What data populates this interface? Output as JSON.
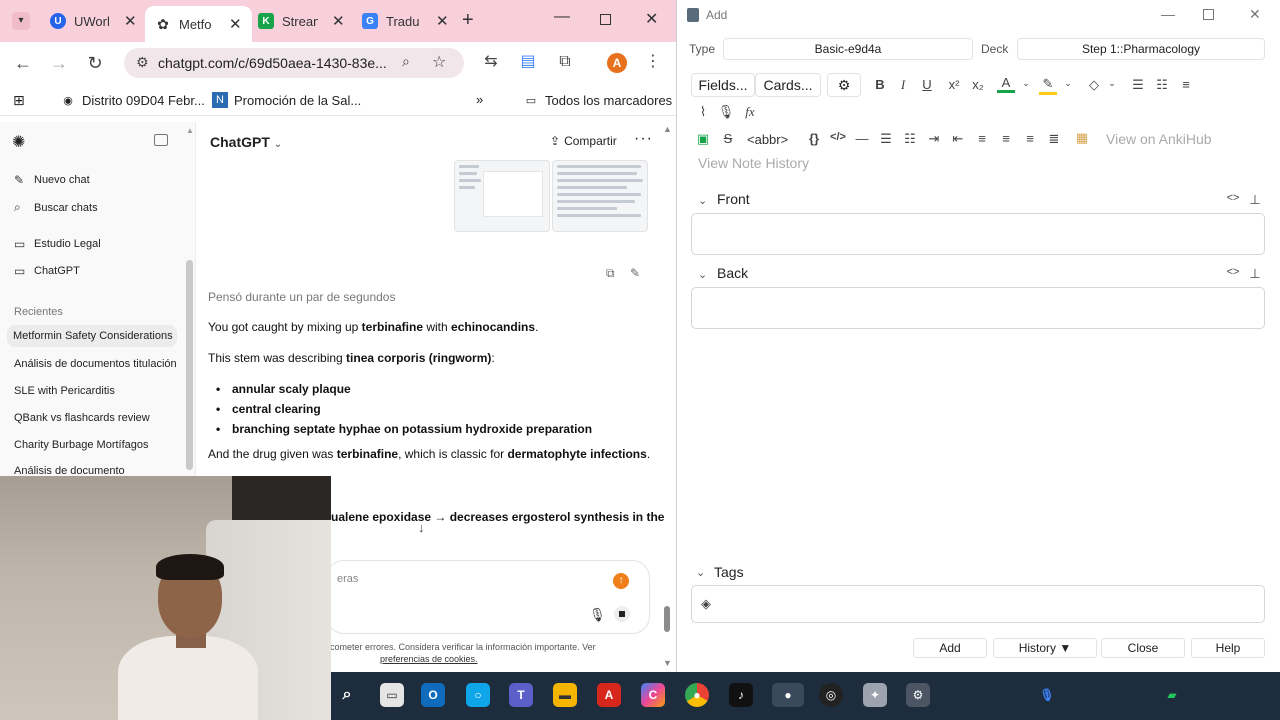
{
  "chrome": {
    "tabs": [
      {
        "title": "UWorl",
        "color": "#2563eb",
        "glyph": "U"
      },
      {
        "title": "Metfo",
        "color": "#444444",
        "glyph": "✿",
        "active": true
      },
      {
        "title": "Strean",
        "color": "#16a34a",
        "glyph": "K"
      },
      {
        "title": "Tradu",
        "color": "#3b82f6",
        "glyph": "G"
      }
    ],
    "url": "chatgpt.com/c/69d50aea-1430-83e...",
    "profile_initial": "A",
    "bookmarks": [
      "Distrito 09D04 Febr...",
      "Promoción de la Sal...",
      "Todos los marcadores"
    ]
  },
  "chatgpt": {
    "sidebar": {
      "new_chat": "Nuevo chat",
      "search_chats": "Buscar chats",
      "projects": [
        "Estudio Legal",
        "ChatGPT"
      ],
      "recents_label": "Recientes",
      "recents": [
        "Metformin Safety Considerations",
        "Análisis de documentos titulación",
        "SLE with Pericarditis",
        "QBank vs flashcards review",
        "Charity Burbage Mortífagos",
        "Análisis de documento"
      ]
    },
    "header": {
      "model": "ChatGPT",
      "share": "Compartir"
    },
    "thought": "Pensó durante un par de segundos",
    "line1_a": "You got caught by mixing up ",
    "line1_b": "terbinafine",
    "line1_c": " with ",
    "line1_d": "echinocandins",
    "line1_e": ".",
    "line2_a": "This stem was describing ",
    "line2_b": "tinea corporis (ringworm)",
    "line2_c": ":",
    "bullets": [
      "annular scaly plaque",
      "central clearing",
      "branching septate hyphae on potassium hydroxide preparation"
    ],
    "line3_a": "And the drug given was ",
    "line3_b": "terbinafine",
    "line3_c": ", which is classic for ",
    "line3_d": "dermatophyte infections",
    "line3_e": ".",
    "line4": "ualene epoxidase → decreases ergosterol synthesis in the",
    "composer_placeholder": "eras",
    "disclaimer": "cometer errores. Considera verificar la información importante. Ver",
    "disclaimer_link": "preferencias de cookies."
  },
  "anki": {
    "window_title": "Add",
    "type_label": "Type",
    "type_value": "Basic-e9d4a",
    "deck_label": "Deck",
    "deck_value": "Step 1::Pharmacology",
    "fields_btn": "Fields...",
    "cards_btn": "Cards...",
    "abbr": "<abbr>",
    "ankihub": "View on AnkiHub",
    "history_link": "View Note History",
    "front_label": "Front",
    "back_label": "Back",
    "tags_label": "Tags",
    "buttons": {
      "add": "Add",
      "history": "History ▼",
      "close": "Close",
      "help": "Help"
    }
  },
  "colors": {
    "chrome_tabstrip": "#f8d0dc",
    "anki_bg": "#ffffff",
    "taskbar": "#1e2d3d",
    "accent_orange": "#f07f1b"
  }
}
